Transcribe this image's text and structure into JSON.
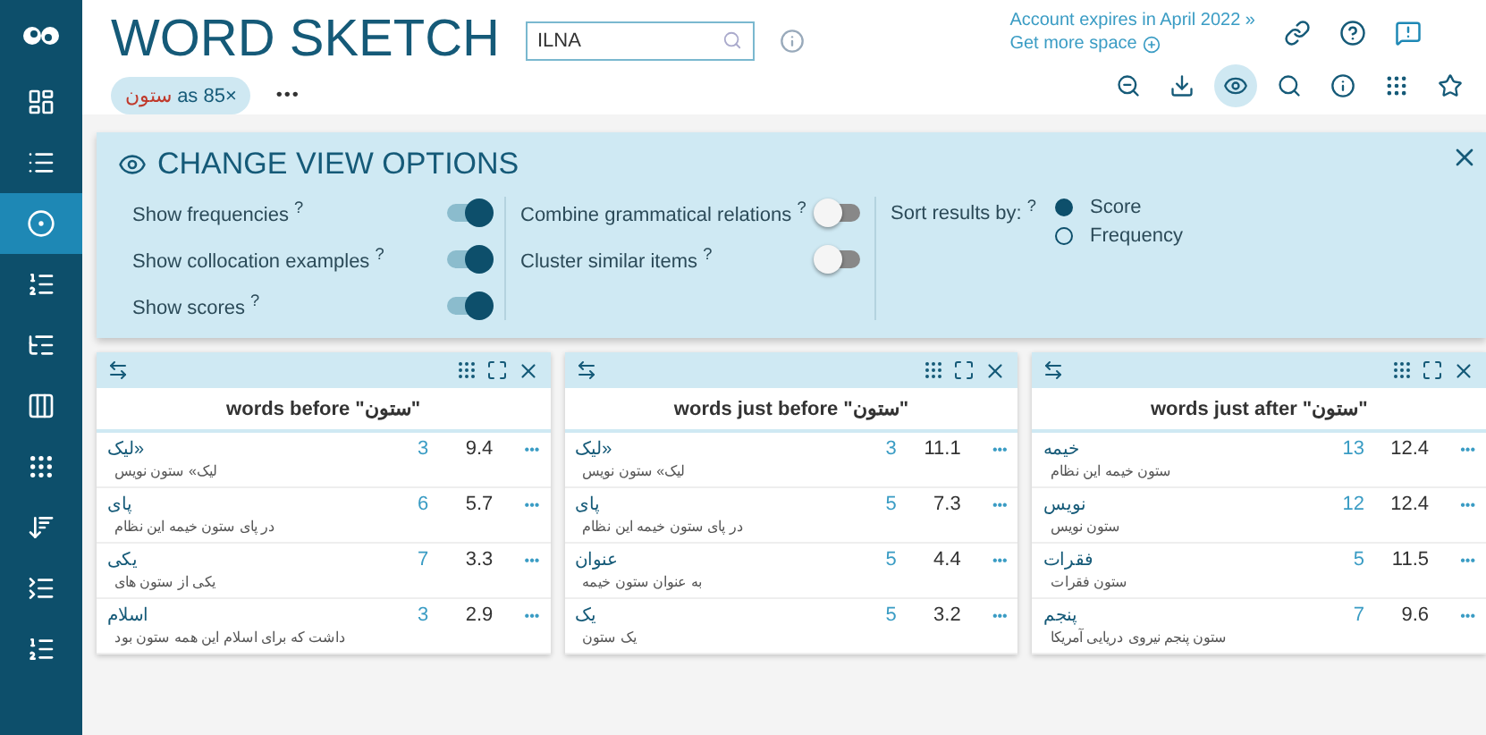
{
  "app": {
    "title": "WORD SKETCH",
    "search": {
      "value": "ILNA"
    }
  },
  "query": {
    "word": "ستون",
    "suffix": "as 85×",
    "more": "•••"
  },
  "account": {
    "expiry": "Account expires in April 2022 »",
    "space": "Get more space"
  },
  "sidebar": {
    "items": [
      {
        "kind": "dashboard",
        "selected": false
      },
      {
        "kind": "list",
        "selected": false
      },
      {
        "kind": "target",
        "selected": true
      },
      {
        "kind": "pair",
        "selected": false
      },
      {
        "kind": "bullet",
        "selected": false
      },
      {
        "kind": "dots",
        "selected": false
      },
      {
        "kind": "grid",
        "selected": false
      },
      {
        "kind": "sortdown",
        "selected": false
      },
      {
        "kind": "n",
        "selected": false
      },
      {
        "kind": "delta",
        "selected": false
      }
    ]
  },
  "toolbar": [
    {
      "kind": "zoomout",
      "selected": false
    },
    {
      "kind": "download",
      "selected": false
    },
    {
      "kind": "eye",
      "selected": true
    },
    {
      "kind": "search",
      "selected": false
    },
    {
      "kind": "info",
      "selected": false
    },
    {
      "kind": "cluster",
      "selected": false
    },
    {
      "kind": "star",
      "selected": false
    }
  ],
  "options": {
    "title": "CHANGE VIEW OPTIONS",
    "help": "?",
    "left_column": {
      "toggles": [
        {
          "label": "Show frequencies",
          "on": true
        },
        {
          "label": "Show collocation examples",
          "on": true
        },
        {
          "label": "Show scores",
          "on": true
        }
      ]
    },
    "middle_column": {
      "toggles": [
        {
          "label": "Combine grammatical relations",
          "on": false
        },
        {
          "label": "Cluster similar items",
          "on": false
        }
      ]
    },
    "sort": {
      "label": "Sort results by:",
      "options": [
        {
          "label": "Score",
          "selected": true
        },
        {
          "label": "Frequency",
          "selected": false
        }
      ]
    }
  },
  "panels": {
    "left": {
      "title": "words before \"ستون\"",
      "rows": [
        {
          "word": "«لیک",
          "example": "لیک» ستون نویس",
          "freq": "3",
          "score": "9.4"
        },
        {
          "word": "پای",
          "example": "در پای ستون خیمه این نظام",
          "freq": "6",
          "score": "5.7"
        },
        {
          "word": "یکی",
          "example": "یکی از ستون های",
          "freq": "7",
          "score": "3.3"
        },
        {
          "word": "اسلام",
          "example": "داشت که برای اسلام این همه ستون بود",
          "freq": "3",
          "score": "2.9"
        }
      ]
    },
    "middle": {
      "title": "words just before \"ستون\"",
      "rows": [
        {
          "word": "«لیک",
          "example": "لیک» ستون نویس",
          "freq": "3",
          "score": "11.1"
        },
        {
          "word": "پای",
          "example": "در پای ستون خیمه این نظام",
          "freq": "5",
          "score": "7.3"
        },
        {
          "word": "عنوان",
          "example": "به عنوان ستون خیمه",
          "freq": "5",
          "score": "4.4"
        },
        {
          "word": "یک",
          "example": "یک ستون",
          "freq": "5",
          "score": "3.2"
        }
      ]
    },
    "right": {
      "title": "words just after \"ستون\"",
      "rows": [
        {
          "word": "خیمه",
          "example": "ستون خیمه این نظام",
          "freq": "13",
          "score": "12.4"
        },
        {
          "word": "نویس",
          "example": "ستون نویس",
          "freq": "12",
          "score": "12.4"
        },
        {
          "word": "فقرات",
          "example": "ستون فقرات",
          "freq": "5",
          "score": "11.5"
        },
        {
          "word": "پنجم",
          "example": "ستون پنجم نیروی دریایی آمریکا",
          "freq": "7",
          "score": "9.6"
        }
      ]
    }
  },
  "row_more": "•••"
}
